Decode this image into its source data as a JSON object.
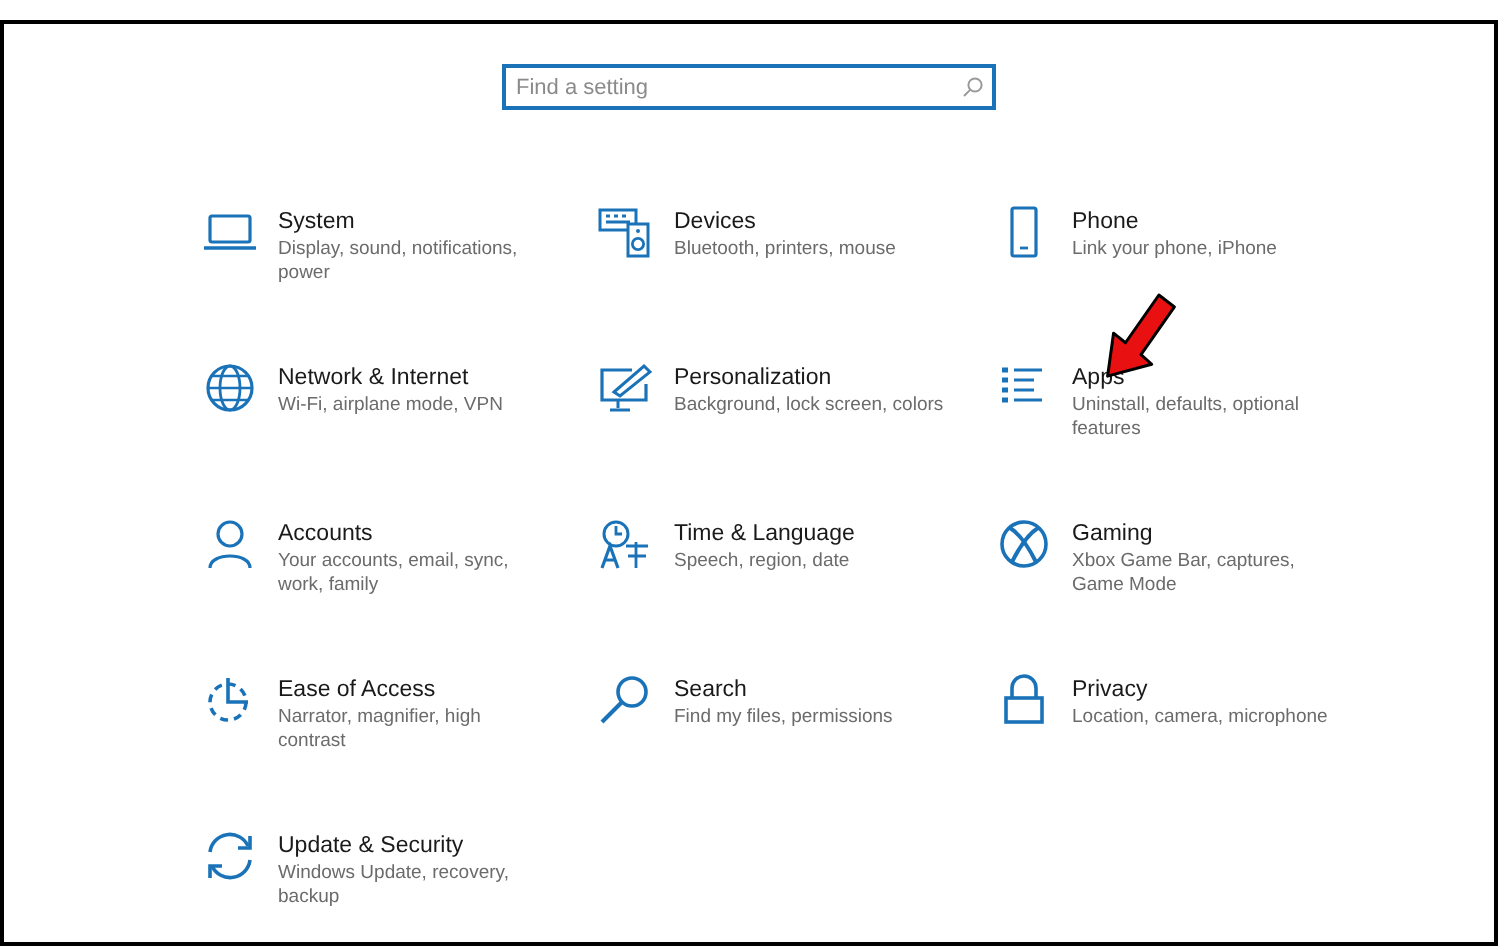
{
  "search": {
    "placeholder": "Find a setting"
  },
  "categories": [
    {
      "title": "System",
      "description": "Display, sound, notifications, power"
    },
    {
      "title": "Devices",
      "description": "Bluetooth, printers, mouse"
    },
    {
      "title": "Phone",
      "description": "Link your phone, iPhone"
    },
    {
      "title": "Network & Internet",
      "description": "Wi-Fi, airplane mode, VPN"
    },
    {
      "title": "Personalization",
      "description": "Background, lock screen, colors"
    },
    {
      "title": "Apps",
      "description": "Uninstall, defaults, optional features"
    },
    {
      "title": "Accounts",
      "description": "Your accounts, email, sync, work, family"
    },
    {
      "title": "Time & Language",
      "description": "Speech, region, date"
    },
    {
      "title": "Gaming",
      "description": "Xbox Game Bar, captures, Game Mode"
    },
    {
      "title": "Ease of Access",
      "description": "Narrator, magnifier, high contrast"
    },
    {
      "title": "Search",
      "description": "Find my files, permissions"
    },
    {
      "title": "Privacy",
      "description": "Location, camera, microphone"
    },
    {
      "title": "Update & Security",
      "description": "Windows Update, recovery, backup"
    }
  ]
}
